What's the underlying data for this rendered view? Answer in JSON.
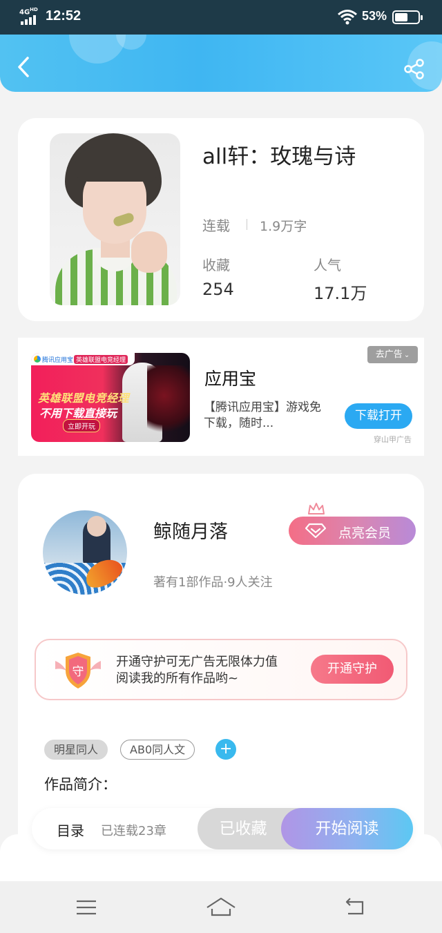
{
  "status_bar": {
    "network": "4G",
    "network_sup": "HD",
    "time": "12:52",
    "battery_pct": "53%",
    "battery_level": 0.53
  },
  "header": {
    "back_icon": "chevron-left-icon",
    "share_icon": "share-icon",
    "gradient": [
      "#52c2f2",
      "#5ac7f7"
    ]
  },
  "book": {
    "title": "all轩：玫瑰与诗",
    "status": "连载",
    "words": "1.9万字",
    "favorites_label": "收藏",
    "favorites_value": "254",
    "popularity_label": "人气",
    "popularity_value": "17.1万"
  },
  "ad": {
    "image_logo": "腾讯应用宝",
    "image_badge": "英雄联盟电竞经理",
    "image_headline1": "英雄联盟电竞经理",
    "image_headline2": "不用下载直接玩",
    "image_cta": "立即开玩",
    "title": "应用宝",
    "description": "【腾讯应用宝】游戏免下载，随时...",
    "remove_label": "去广告",
    "download_label": "下载打开",
    "source": "穿山甲广告"
  },
  "author": {
    "name": "鲸随月落",
    "meta": "著有1部作品·9人关注",
    "vip_label": "点亮会员",
    "vip_gradient": [
      "#f46e86",
      "#b88ad8"
    ]
  },
  "guard": {
    "badge_char": "守",
    "text": "开通守护可无广告无限体力值阅读我的所有作品哟~",
    "button_label": "开通守护"
  },
  "tags": [
    "明星同人",
    "AB0同人文"
  ],
  "intro_label": "作品简介：",
  "action_bar": {
    "toc_label": "目录",
    "chapters": "已连载23章",
    "collected_label": "已收藏",
    "read_label": "开始阅读"
  },
  "system_nav": {
    "menu_icon": "menu-icon",
    "home_icon": "home-icon",
    "back_icon": "back-icon"
  }
}
